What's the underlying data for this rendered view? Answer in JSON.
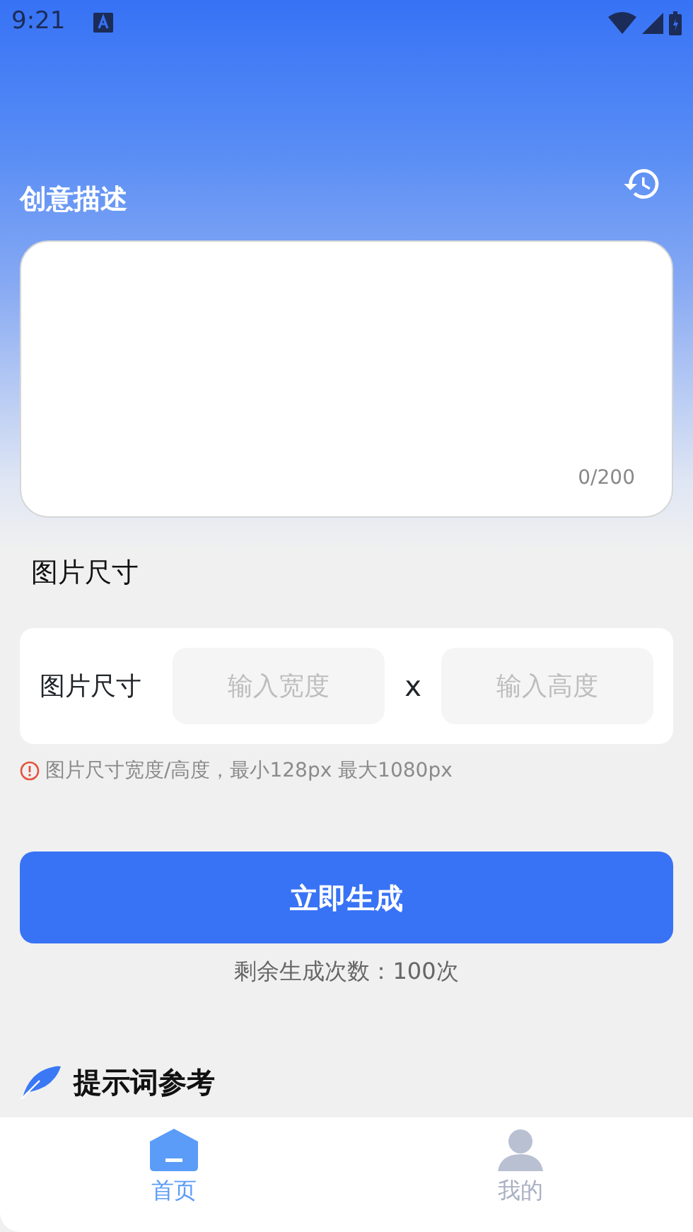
{
  "status_bar": {
    "time": "9:21"
  },
  "description": {
    "title": "创意描述",
    "counter": "0/200"
  },
  "size_section": {
    "title": "图片尺寸",
    "label": "图片尺寸",
    "width_placeholder": "输入宽度",
    "separator": "x",
    "height_placeholder": "输入高度",
    "hint": "图片尺寸宽度/高度，最小128px 最大1080px"
  },
  "generate_button": "立即生成",
  "remaining": "剩余生成次数：100次",
  "prompt_section": {
    "title": "提示词参考"
  },
  "tabs": [
    {
      "label": "首页",
      "selected": true,
      "kind": "home"
    },
    {
      "label": "我的",
      "selected": false,
      "kind": "profile"
    }
  ]
}
